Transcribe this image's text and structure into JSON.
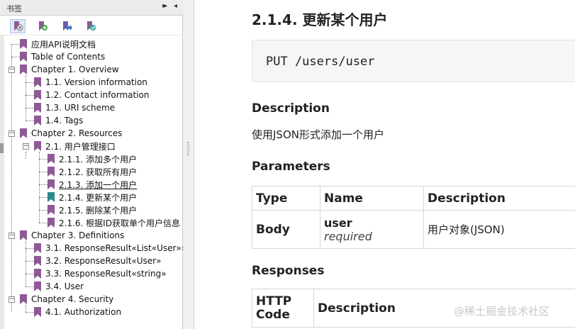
{
  "sidebar": {
    "title": "书签",
    "collapse_glyph": "▸▸",
    "close_glyph": "◂",
    "toolbar": [
      {
        "icon": "delete-bookmark-icon"
      },
      {
        "icon": "add-bookmark-icon"
      },
      {
        "icon": "goto-bookmark-icon"
      },
      {
        "icon": "expand-bookmark-icon"
      }
    ],
    "items": [
      {
        "label": "应用API说明文档"
      },
      {
        "label": "Table of Contents"
      },
      {
        "label": "Chapter 1. Overview"
      },
      {
        "label": "1.1. Version information"
      },
      {
        "label": "1.2. Contact information"
      },
      {
        "label": "1.3. URI scheme"
      },
      {
        "label": "1.4. Tags"
      },
      {
        "label": "Chapter 2. Resources"
      },
      {
        "label": "2.1. 用户管理接口"
      },
      {
        "label": "2.1.1. 添加多个用户"
      },
      {
        "label": "2.1.2. 获取所有用户"
      },
      {
        "label": "2.1.3. 添加一个用户"
      },
      {
        "label": "2.1.4. 更新某个用户"
      },
      {
        "label": "2.1.5. 删除某个用户"
      },
      {
        "label": "2.1.6. 根据ID获取单个用户信息"
      },
      {
        "label": "Chapter 3. Definitions"
      },
      {
        "label": "3.1. ResponseResult«List«User»»"
      },
      {
        "label": "3.2. ResponseResult«User»"
      },
      {
        "label": "3.3. ResponseResult«string»"
      },
      {
        "label": "3.4. User"
      },
      {
        "label": "Chapter 4. Security"
      },
      {
        "label": "4.1. Authorization"
      }
    ],
    "colors": {
      "bookmark": "#8e5a96",
      "bookmark_current": "#2a8a8a"
    }
  },
  "main": {
    "title": "2.1.4. 更新某个用户",
    "code": "PUT /users/user",
    "description_heading": "Description",
    "description_text": "使用JSON形式添加一个用户",
    "parameters_heading": "Parameters",
    "parameters_table": {
      "headers": [
        "Type",
        "Name",
        "Description"
      ],
      "rows": [
        {
          "type": "Body",
          "name": "user",
          "required": "required",
          "description": "用户对象(JSON)"
        }
      ]
    },
    "responses_heading": "Responses",
    "responses_table": {
      "headers": [
        "HTTP Code",
        "Description"
      ]
    }
  },
  "watermark": "@稀土掘金技术社区"
}
